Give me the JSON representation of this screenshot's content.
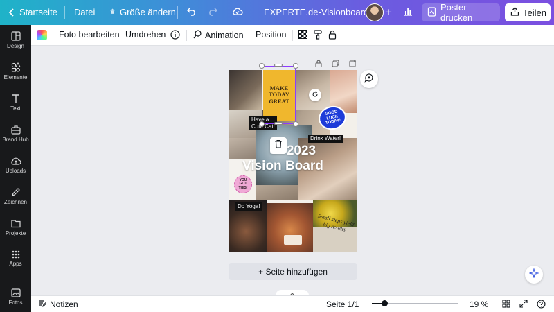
{
  "topbar": {
    "home_label": "Startseite",
    "file_label": "Datei",
    "resize_label": "Größe ändern",
    "doc_title": "EXPERTE.de-Visionboard",
    "print_label": "Poster drucken",
    "share_label": "Teilen",
    "gradient_start": "#1fb3c8",
    "gradient_end": "#7b4fe0"
  },
  "sidebar": {
    "items": [
      {
        "label": "Design",
        "icon": "design-icon"
      },
      {
        "label": "Elemente",
        "icon": "elements-icon"
      },
      {
        "label": "Text",
        "icon": "text-icon"
      },
      {
        "label": "Brand Hub",
        "icon": "brand-hub-icon"
      },
      {
        "label": "Uploads",
        "icon": "uploads-icon"
      },
      {
        "label": "Zeichnen",
        "icon": "draw-icon"
      },
      {
        "label": "Projekte",
        "icon": "folder-icon"
      },
      {
        "label": "Apps",
        "icon": "apps-icon"
      },
      {
        "label": "Fotos",
        "icon": "photos-icon"
      }
    ]
  },
  "context_toolbar": {
    "edit_photo": "Foto bearbeiten",
    "flip": "Umdrehen",
    "animation": "Animation",
    "position": "Position"
  },
  "board": {
    "sticker_make_today": "MAKE TODAY GREAT",
    "cute_cat": "Have a Cute Cat!",
    "drink_water": "Drink Water!",
    "year": "2023",
    "title": "Vision Board",
    "good_luck": "GOOD LUCK TODAY!",
    "you_got_this": "YOU GOT THIS!",
    "do_yoga": "Do Yoga!",
    "small_steps": "Small steps yield big results"
  },
  "canvas": {
    "add_page_label": "+ Seite hinzufügen"
  },
  "bottombar": {
    "notes_label": "Notizen",
    "page_label": "Seite 1/1",
    "zoom_label": "19 %",
    "zoom_fraction": 0.15
  }
}
